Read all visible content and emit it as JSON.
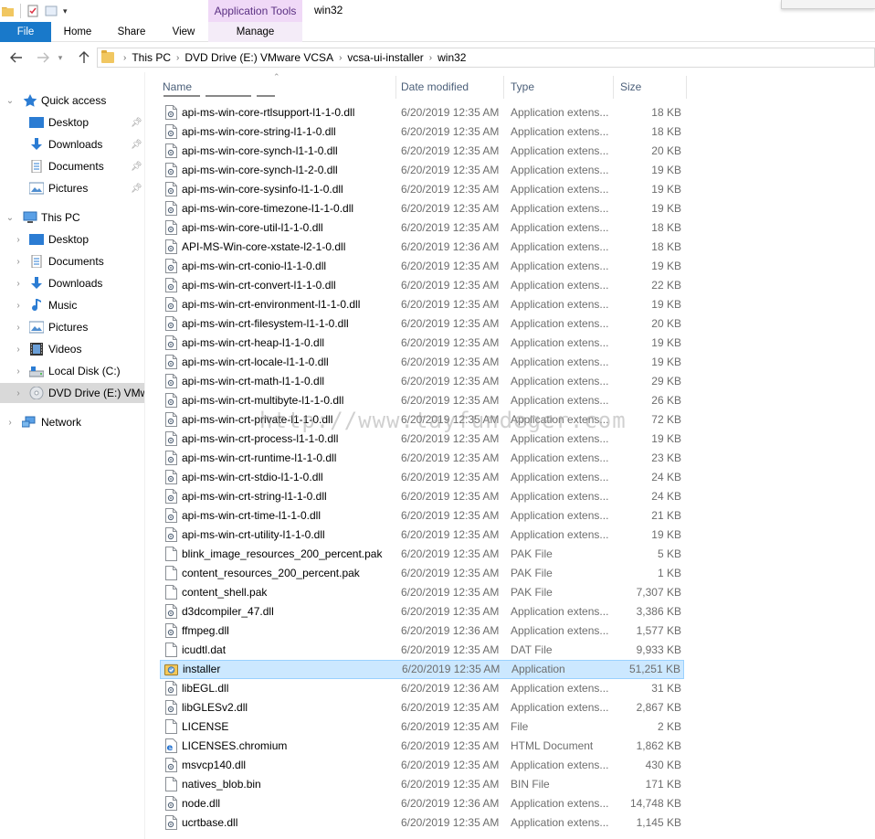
{
  "ribbon": {
    "context_tab_group": "Application Tools",
    "window_title": "win32",
    "tabs": {
      "file": "File",
      "home": "Home",
      "share": "Share",
      "view": "View",
      "manage": "Manage"
    }
  },
  "address": {
    "crumbs": [
      "This PC",
      "DVD Drive (E:) VMware VCSA",
      "vcsa-ui-installer",
      "win32"
    ]
  },
  "nav": {
    "quick_access": "Quick access",
    "quick_items": [
      "Desktop",
      "Downloads",
      "Documents",
      "Pictures"
    ],
    "this_pc": "This PC",
    "pc_items": [
      "Desktop",
      "Documents",
      "Downloads",
      "Music",
      "Pictures",
      "Videos",
      "Local Disk (C:)",
      "DVD Drive (E:) VMware VCSA"
    ],
    "network": "Network"
  },
  "columns": {
    "name": "Name",
    "date": "Date modified",
    "type": "Type",
    "size": "Size"
  },
  "files": [
    {
      "name": "api-ms-win-core-rtlsupport-l1-1-0.dll",
      "date": "6/20/2019 12:35 AM",
      "type": "Application extens...",
      "size": "18 KB",
      "icon": "dll-icon"
    },
    {
      "name": "api-ms-win-core-string-l1-1-0.dll",
      "date": "6/20/2019 12:35 AM",
      "type": "Application extens...",
      "size": "18 KB",
      "icon": "dll-icon"
    },
    {
      "name": "api-ms-win-core-synch-l1-1-0.dll",
      "date": "6/20/2019 12:35 AM",
      "type": "Application extens...",
      "size": "20 KB",
      "icon": "dll-icon"
    },
    {
      "name": "api-ms-win-core-synch-l1-2-0.dll",
      "date": "6/20/2019 12:35 AM",
      "type": "Application extens...",
      "size": "19 KB",
      "icon": "dll-icon"
    },
    {
      "name": "api-ms-win-core-sysinfo-l1-1-0.dll",
      "date": "6/20/2019 12:35 AM",
      "type": "Application extens...",
      "size": "19 KB",
      "icon": "dll-icon"
    },
    {
      "name": "api-ms-win-core-timezone-l1-1-0.dll",
      "date": "6/20/2019 12:35 AM",
      "type": "Application extens...",
      "size": "19 KB",
      "icon": "dll-icon"
    },
    {
      "name": "api-ms-win-core-util-l1-1-0.dll",
      "date": "6/20/2019 12:35 AM",
      "type": "Application extens...",
      "size": "18 KB",
      "icon": "dll-icon"
    },
    {
      "name": "API-MS-Win-core-xstate-l2-1-0.dll",
      "date": "6/20/2019 12:36 AM",
      "type": "Application extens...",
      "size": "18 KB",
      "icon": "dll-icon"
    },
    {
      "name": "api-ms-win-crt-conio-l1-1-0.dll",
      "date": "6/20/2019 12:35 AM",
      "type": "Application extens...",
      "size": "19 KB",
      "icon": "dll-icon"
    },
    {
      "name": "api-ms-win-crt-convert-l1-1-0.dll",
      "date": "6/20/2019 12:35 AM",
      "type": "Application extens...",
      "size": "22 KB",
      "icon": "dll-icon"
    },
    {
      "name": "api-ms-win-crt-environment-l1-1-0.dll",
      "date": "6/20/2019 12:35 AM",
      "type": "Application extens...",
      "size": "19 KB",
      "icon": "dll-icon"
    },
    {
      "name": "api-ms-win-crt-filesystem-l1-1-0.dll",
      "date": "6/20/2019 12:35 AM",
      "type": "Application extens...",
      "size": "20 KB",
      "icon": "dll-icon"
    },
    {
      "name": "api-ms-win-crt-heap-l1-1-0.dll",
      "date": "6/20/2019 12:35 AM",
      "type": "Application extens...",
      "size": "19 KB",
      "icon": "dll-icon"
    },
    {
      "name": "api-ms-win-crt-locale-l1-1-0.dll",
      "date": "6/20/2019 12:35 AM",
      "type": "Application extens...",
      "size": "19 KB",
      "icon": "dll-icon"
    },
    {
      "name": "api-ms-win-crt-math-l1-1-0.dll",
      "date": "6/20/2019 12:35 AM",
      "type": "Application extens...",
      "size": "29 KB",
      "icon": "dll-icon"
    },
    {
      "name": "api-ms-win-crt-multibyte-l1-1-0.dll",
      "date": "6/20/2019 12:35 AM",
      "type": "Application extens...",
      "size": "26 KB",
      "icon": "dll-icon"
    },
    {
      "name": "api-ms-win-crt-private-l1-1-0.dll",
      "date": "6/20/2019 12:35 AM",
      "type": "Application extens...",
      "size": "72 KB",
      "icon": "dll-icon"
    },
    {
      "name": "api-ms-win-crt-process-l1-1-0.dll",
      "date": "6/20/2019 12:35 AM",
      "type": "Application extens...",
      "size": "19 KB",
      "icon": "dll-icon"
    },
    {
      "name": "api-ms-win-crt-runtime-l1-1-0.dll",
      "date": "6/20/2019 12:35 AM",
      "type": "Application extens...",
      "size": "23 KB",
      "icon": "dll-icon"
    },
    {
      "name": "api-ms-win-crt-stdio-l1-1-0.dll",
      "date": "6/20/2019 12:35 AM",
      "type": "Application extens...",
      "size": "24 KB",
      "icon": "dll-icon"
    },
    {
      "name": "api-ms-win-crt-string-l1-1-0.dll",
      "date": "6/20/2019 12:35 AM",
      "type": "Application extens...",
      "size": "24 KB",
      "icon": "dll-icon"
    },
    {
      "name": "api-ms-win-crt-time-l1-1-0.dll",
      "date": "6/20/2019 12:35 AM",
      "type": "Application extens...",
      "size": "21 KB",
      "icon": "dll-icon"
    },
    {
      "name": "api-ms-win-crt-utility-l1-1-0.dll",
      "date": "6/20/2019 12:35 AM",
      "type": "Application extens...",
      "size": "19 KB",
      "icon": "dll-icon"
    },
    {
      "name": "blink_image_resources_200_percent.pak",
      "date": "6/20/2019 12:35 AM",
      "type": "PAK File",
      "size": "5 KB",
      "icon": "file-icon"
    },
    {
      "name": "content_resources_200_percent.pak",
      "date": "6/20/2019 12:35 AM",
      "type": "PAK File",
      "size": "1 KB",
      "icon": "file-icon"
    },
    {
      "name": "content_shell.pak",
      "date": "6/20/2019 12:35 AM",
      "type": "PAK File",
      "size": "7,307 KB",
      "icon": "file-icon"
    },
    {
      "name": "d3dcompiler_47.dll",
      "date": "6/20/2019 12:35 AM",
      "type": "Application extens...",
      "size": "3,386 KB",
      "icon": "dll-icon"
    },
    {
      "name": "ffmpeg.dll",
      "date": "6/20/2019 12:36 AM",
      "type": "Application extens...",
      "size": "1,577 KB",
      "icon": "dll-icon"
    },
    {
      "name": "icudtl.dat",
      "date": "6/20/2019 12:35 AM",
      "type": "DAT File",
      "size": "9,933 KB",
      "icon": "file-icon"
    },
    {
      "name": "installer",
      "date": "6/20/2019 12:35 AM",
      "type": "Application",
      "size": "51,251 KB",
      "icon": "app-icon",
      "selected": true
    },
    {
      "name": "libEGL.dll",
      "date": "6/20/2019 12:36 AM",
      "type": "Application extens...",
      "size": "31 KB",
      "icon": "dll-icon"
    },
    {
      "name": "libGLESv2.dll",
      "date": "6/20/2019 12:35 AM",
      "type": "Application extens...",
      "size": "2,867 KB",
      "icon": "dll-icon"
    },
    {
      "name": "LICENSE",
      "date": "6/20/2019 12:35 AM",
      "type": "File",
      "size": "2 KB",
      "icon": "file-icon"
    },
    {
      "name": "LICENSES.chromium",
      "date": "6/20/2019 12:35 AM",
      "type": "HTML Document",
      "size": "1,862 KB",
      "icon": "html-icon"
    },
    {
      "name": "msvcp140.dll",
      "date": "6/20/2019 12:35 AM",
      "type": "Application extens...",
      "size": "430 KB",
      "icon": "dll-icon"
    },
    {
      "name": "natives_blob.bin",
      "date": "6/20/2019 12:35 AM",
      "type": "BIN File",
      "size": "171 KB",
      "icon": "file-icon"
    },
    {
      "name": "node.dll",
      "date": "6/20/2019 12:36 AM",
      "type": "Application extens...",
      "size": "14,748 KB",
      "icon": "dll-icon"
    },
    {
      "name": "ucrtbase.dll",
      "date": "6/20/2019 12:35 AM",
      "type": "Application extens...",
      "size": "1,145 KB",
      "icon": "dll-icon"
    }
  ],
  "watermark": "http://www.tayfundeger.com",
  "colors": {
    "file_tab": "#1979ca",
    "context_tab": "#f0d9f7",
    "selection": "#cce8ff",
    "selection_border": "#99d1ff",
    "header_text": "#4c607a"
  }
}
